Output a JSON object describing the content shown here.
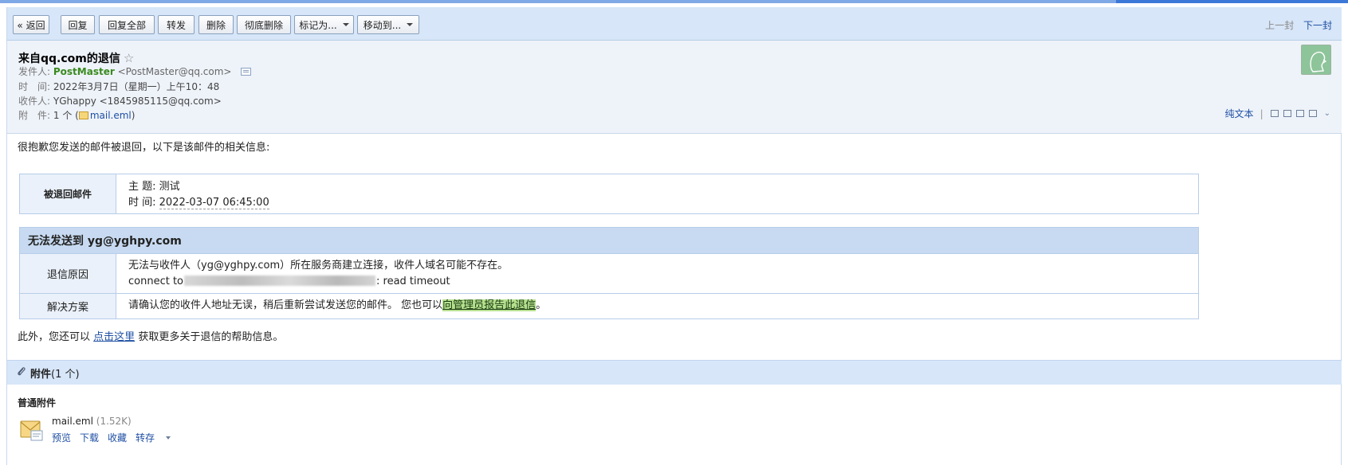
{
  "toolbar": {
    "back": "« 返回",
    "reply": "回复",
    "reply_all": "回复全部",
    "forward": "转发",
    "delete": "删除",
    "delete_forever": "彻底删除",
    "mark_as": "标记为...",
    "move_to": "移动到...",
    "prev": "上一封",
    "next": "下一封"
  },
  "header": {
    "subject": "来自qq.com的退信",
    "star": "☆",
    "from_label": "发件人:",
    "from_name": "PostMaster",
    "from_addr": "<PostMaster@qq.com>",
    "time_label": "时　间:",
    "time_value": "2022年3月7日（星期一）上午10：48",
    "to_label": "收件人:",
    "to_value": "YGhappy <1845985115@qq.com>",
    "attach_label": "附　件:",
    "attach_count": "1 个 (",
    "attach_file": "mail.eml",
    "attach_close": ")",
    "plain_text": "纯文本",
    "avatar": "user-silhouette-icon"
  },
  "body": {
    "intro": "很抱歉您发送的邮件被退回，以下是该邮件的相关信息:",
    "bounced_label": "被退回邮件",
    "subject_line_label": "主 题:",
    "subject_line_value": "测试",
    "time_line_label": "时 间:",
    "time_line_value": "2022-03-07 06:45:00",
    "fail_title": "无法发送到 yg@yghpy.com",
    "reason_label": "退信原因",
    "reason_line1": "无法与收件人（yg@yghpy.com）所在服务商建立连接，收件人域名可能不存在。",
    "reason_line2_prefix": "connect to",
    "reason_line2_suffix": ": read timeout",
    "solution_label": "解决方案",
    "solution_text": "请确认您的收件人地址无误，稍后重新尝试发送您的邮件。 您也可以",
    "solution_link": "向管理员报告此退信",
    "solution_end": "。",
    "also_prefix": "此外，您还可以",
    "also_link": "点击这里",
    "also_suffix": "获取更多关于退信的帮助信息。"
  },
  "attachments": {
    "bar_label": "附件",
    "bar_count": "(1 个)",
    "section_title": "普通附件",
    "file_name": "mail.eml",
    "file_size": "(1.52K)",
    "actions": [
      "预览",
      "下载",
      "收藏",
      "转存"
    ]
  },
  "colors": {
    "toolbar_bg": "#d7e6f8",
    "header_bg": "#eef3fa",
    "link": "#1f4fa3",
    "sender": "#3a8a1f",
    "table_head": "#c7daf1",
    "highlight": "#b6e08f"
  }
}
